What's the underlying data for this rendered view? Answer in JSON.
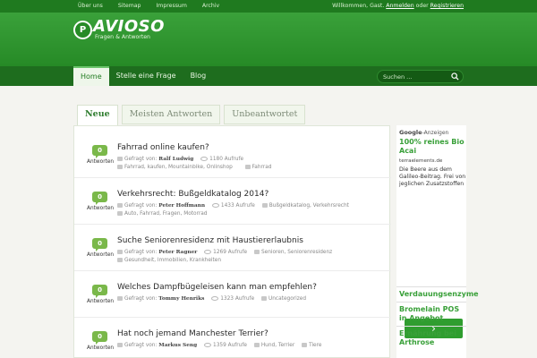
{
  "topbar": {
    "links": [
      "Über uns",
      "Sitemap",
      "Impressum",
      "Archiv"
    ],
    "welcome_prefix": "Willkommen, Gast.",
    "login": "Anmelden",
    "or": "oder",
    "register": "Registrieren"
  },
  "logo": {
    "badge": "P",
    "name": "AVIOSO",
    "tagline": "Fragen & Antworten"
  },
  "nav": {
    "items": [
      "Home",
      "Stelle eine Frage",
      "Blog"
    ],
    "active": "Home"
  },
  "search": {
    "placeholder": "Suchen ..."
  },
  "tabs": [
    "Neue",
    "Meisten Antworten",
    "Unbeantwortet"
  ],
  "questions": [
    {
      "answers": "0",
      "answers_label": "Antworten",
      "title": "Fahrrad online kaufen?",
      "asked_by_label": "Gefragt von:",
      "author": "Ralf Ludwig",
      "views": "1180 Aufrufe",
      "tags": "Fahrrad, kaufen, Mountainbike, Onlinshop",
      "category": "Fahrrad"
    },
    {
      "answers": "0",
      "answers_label": "Antworten",
      "title": "Verkehrsrecht: Bußgeldkatalog 2014?",
      "asked_by_label": "Gefragt von:",
      "author": "Peter Hoffmann",
      "views": "1433 Aufrufe",
      "tags": "Bußgeldkatalog, Verkehrsrecht",
      "category": "Auto, Fahrrad, Fragen, Motorrad"
    },
    {
      "answers": "0",
      "answers_label": "Antworten",
      "title": "Suche Seniorenresidenz mit Haustiererlaubnis",
      "asked_by_label": "Gefragt von:",
      "author": "Peter Ragner",
      "views": "1269 Aufrufe",
      "tags": "Senioren, Seniorenresidenz",
      "category": "Gesundheit, Immobilien, Krankheiten"
    },
    {
      "answers": "0",
      "answers_label": "Antworten",
      "title": "Welches Dampfbügeleisen kann man empfehlen?",
      "asked_by_label": "Gefragt von:",
      "author": "Tommy Henriks",
      "views": "1323 Aufrufe",
      "tags": "Uncategorized",
      "category": ""
    },
    {
      "answers": "0",
      "answers_label": "Antworten",
      "title": "Hat noch jemand Manchester Terrier?",
      "asked_by_label": "Gefragt von:",
      "author": "Markus Seng",
      "views": "1359 Aufrufe",
      "tags": "Hund, Terrier",
      "category": "Tiere"
    }
  ],
  "ad": {
    "google_brand": "Google",
    "google_label": "-Anzeigen",
    "title": "100% reines Bio Acai",
    "domain": "terraelements.de",
    "text": "Die Beere aus dem Galileo-Beitrag. Frei von jeglichen Zusatzstoffen",
    "button": "›",
    "links": [
      "Verdauungsenzyme",
      "Bromelain POS in Angebot",
      "Ernährung bei Arthrose"
    ]
  }
}
